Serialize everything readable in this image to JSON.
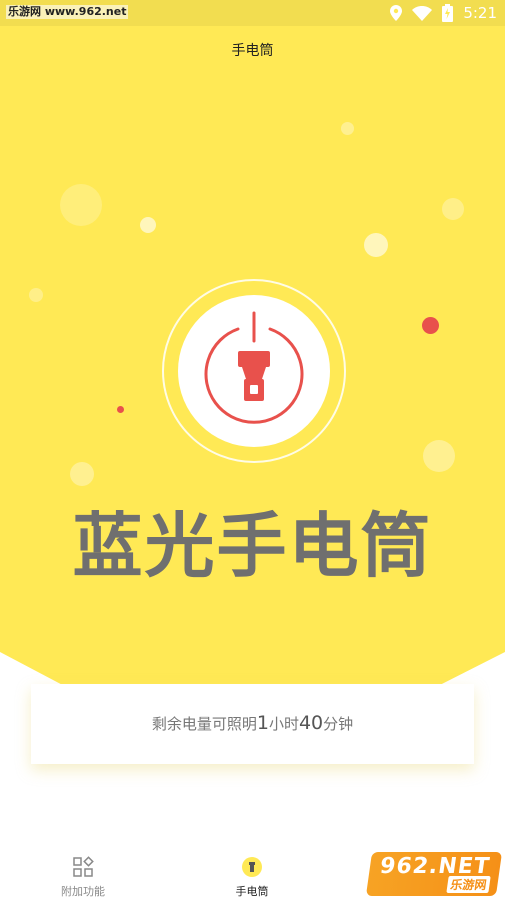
{
  "status_bar": {
    "left_label": "乐游网 www.962.net",
    "time": "5:21",
    "icons": [
      "location-icon",
      "wifi-icon",
      "battery-charging-icon"
    ]
  },
  "header": {
    "title": "手电筒"
  },
  "hero": {
    "title": "蓝光手电筒",
    "toggle_icon": "flashlight-power-icon",
    "accent_color": "#e8514c",
    "background_color": "#ffe955"
  },
  "battery": {
    "prefix": "剩余电量可照明",
    "hours": "1",
    "hours_unit": "小时",
    "minutes": "40",
    "minutes_unit": "分钟"
  },
  "bottom_nav": {
    "items": [
      {
        "label": "附加功能",
        "icon": "grid-icon",
        "active": false
      },
      {
        "label": "手电筒",
        "icon": "flashlight-icon",
        "active": true
      }
    ]
  },
  "watermark": {
    "top": "962.NET",
    "bottom": "乐游网"
  }
}
